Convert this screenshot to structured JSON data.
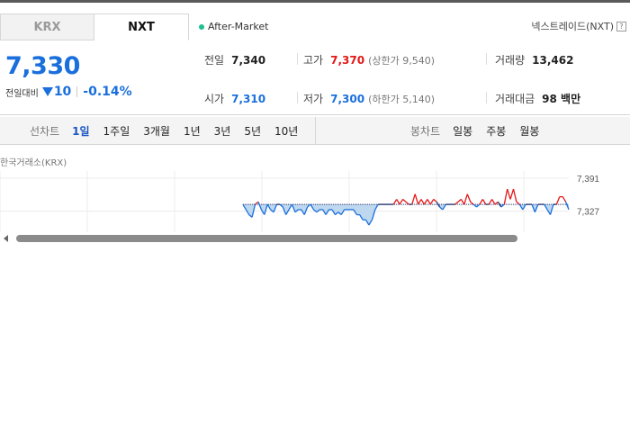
{
  "market_tabs": [
    {
      "label": "KRX",
      "active": false
    },
    {
      "label": "NXT",
      "active": true
    }
  ],
  "session": "After-Market",
  "venue": {
    "label": "넥스트레이드(NXT)",
    "help": "?"
  },
  "quote": {
    "price": "7,330",
    "change_label": "전일대비",
    "change": "10",
    "change_pct": "-0.14%",
    "direction": "down"
  },
  "stats": {
    "prev_close": {
      "label": "전일",
      "value": "7,340"
    },
    "open": {
      "label": "시가",
      "value": "7,310"
    },
    "high": {
      "label": "고가",
      "value": "7,370",
      "limit_label": "(상한가 9,540)"
    },
    "low": {
      "label": "저가",
      "value": "7,300",
      "limit_label": "(하한가 5,140)"
    },
    "volume": {
      "label": "거래량",
      "value": "13,462"
    },
    "amount": {
      "label": "거래대금",
      "value": "98 백만"
    }
  },
  "line_chart": {
    "title": "선차트",
    "periods": [
      "1일",
      "1주일",
      "3개월",
      "1년",
      "3년",
      "5년",
      "10년"
    ],
    "selected": "1일"
  },
  "candle_chart": {
    "title": "봉차트",
    "periods": [
      "일봉",
      "주봉",
      "월봉"
    ]
  },
  "chart_source": "한국거래소(KRX)",
  "chart_data": {
    "type": "line",
    "baseline": 7340,
    "ylim": [
      7300,
      7391
    ],
    "y_ticks": [
      "7,391",
      "7,327"
    ],
    "y_tick_values": [
      7391,
      7327
    ],
    "series": [
      {
        "values": [
          7340,
          7340,
          7340,
          7340,
          7340,
          7340,
          7340,
          7340,
          7340,
          7340,
          7340,
          7340,
          7340,
          7340,
          7340,
          7340,
          7340,
          7340,
          7340,
          7340,
          7340,
          7340,
          7340,
          7340,
          7340,
          7340,
          7340,
          7340,
          7340,
          7340,
          7340,
          7340,
          7340,
          7340,
          7340,
          7340,
          7340,
          7340,
          7340,
          7340,
          7340,
          7340,
          7340,
          7340,
          7340,
          7340,
          7340,
          7340,
          7340,
          7340,
          7340,
          7340,
          7340,
          7340,
          7340,
          7340,
          7340,
          7340,
          7340,
          7340,
          7340,
          7340,
          7340,
          7340,
          7340,
          7340,
          7340,
          7340,
          7340,
          7340,
          7340,
          7340,
          7340,
          7340,
          7340,
          7340,
          7340,
          7340,
          7340,
          7340,
          7330,
          7320,
          7315,
          7340,
          7345,
          7330,
          7320,
          7340,
          7330,
          7325,
          7340,
          7340,
          7335,
          7320,
          7330,
          7340,
          7325,
          7330,
          7330,
          7320,
          7335,
          7340,
          7330,
          7325,
          7330,
          7330,
          7320,
          7330,
          7330,
          7320,
          7325,
          7320,
          7330,
          7330,
          7330,
          7330,
          7320,
          7320,
          7310,
          7310,
          7300,
          7310,
          7330,
          7340,
          7340,
          7340,
          7340,
          7340,
          7340,
          7350,
          7340,
          7350,
          7345,
          7340,
          7340,
          7360,
          7340,
          7350,
          7340,
          7350,
          7340,
          7350,
          7345,
          7335,
          7330,
          7340,
          7340,
          7340,
          7340,
          7345,
          7350,
          7340,
          7360,
          7345,
          7340,
          7335,
          7340,
          7350,
          7340,
          7340,
          7350,
          7340,
          7345,
          7335,
          7340,
          7370,
          7350,
          7370,
          7345,
          7340,
          7330,
          7340,
          7340,
          7340,
          7325,
          7340,
          7340,
          7340,
          7330,
          7320,
          7340,
          7340,
          7355,
          7355,
          7345,
          7330
        ]
      }
    ]
  }
}
